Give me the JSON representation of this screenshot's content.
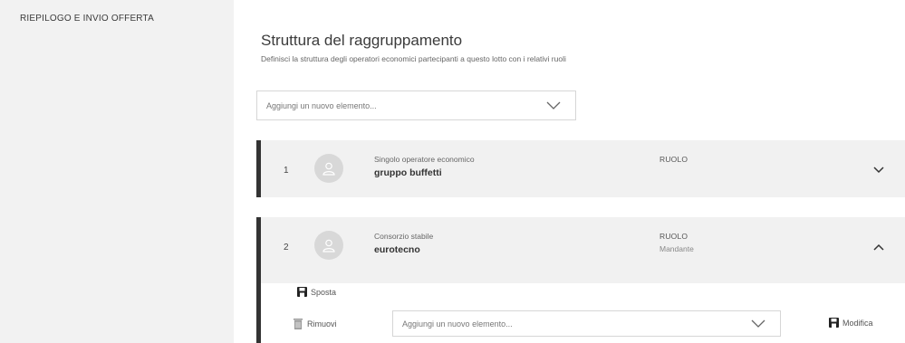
{
  "sidebar": {
    "item_label": "RIEPILOGO E INVIO OFFERTA"
  },
  "main": {
    "title": "Struttura del raggruppamento",
    "subtitle": "Definisci la struttura degli operatori economici partecipanti a questo lotto con i relativi ruoli",
    "add_dropdown": {
      "placeholder": "Aggiungi un nuovo elemento..."
    }
  },
  "members": [
    {
      "number": "1",
      "type": "Singolo operatore economico",
      "name": "gruppo buffetti",
      "role_label": "RUOLO",
      "role_value": "",
      "expanded": false
    },
    {
      "number": "2",
      "type": "Consorzio stabile",
      "name": "eurotecno",
      "role_label": "RUOLO",
      "role_value": "Mandante",
      "expanded": true,
      "actions": {
        "move_label": "Sposta",
        "remove_label": "Rimuovi",
        "edit_label": "Modifica"
      },
      "add_dropdown": {
        "placeholder": "Aggiungi un nuovo elemento..."
      }
    }
  ],
  "icons": {
    "avatar": "user-icon",
    "chevron_down": "chevron-down-icon",
    "chevron_up": "chevron-up-icon",
    "save": "floppy-icon",
    "trash": "trash-icon"
  },
  "colors": {
    "sidebar_bg": "#f2f2f2",
    "card_bg": "#f1f1f1",
    "card_accent": "#333333"
  }
}
